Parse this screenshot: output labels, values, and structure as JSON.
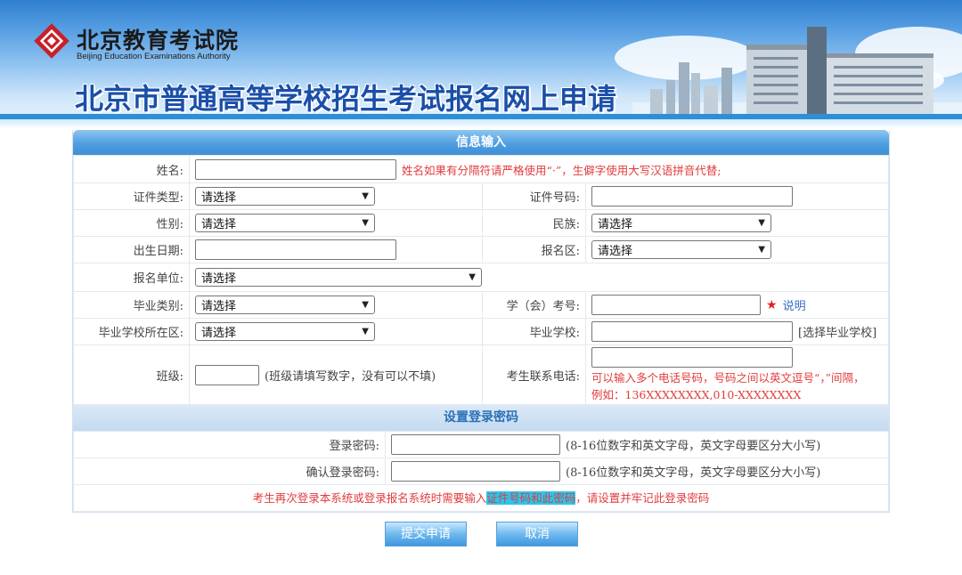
{
  "header": {
    "org_name_cn": "北京教育考试院",
    "org_name_en": "Beijing Education Examinations Authority",
    "site_title": "北京市普通高等学校招生考试报名网上申请"
  },
  "info_section": {
    "title": "信息输入",
    "name_label": "姓名:",
    "name_hint": "姓名如果有分隔符请严格使用“·”，生僻字使用大写汉语拼音代替;",
    "id_type_label": "证件类型:",
    "id_type_value": "请选择",
    "id_number_label": "证件号码:",
    "gender_label": "性别:",
    "gender_value": "请选择",
    "ethnicity_label": "民族:",
    "ethnicity_value": "请选择",
    "birth_label": "出生日期:",
    "district_label": "报名区:",
    "district_value": "请选择",
    "unit_label": "报名单位:",
    "unit_value": "请选择",
    "grad_type_label": "毕业类别:",
    "grad_type_value": "请选择",
    "exam_no_label": "学（会）考号:",
    "exam_no_star": "★",
    "exam_no_link": "说明",
    "school_district_label": "毕业学校所在区:",
    "school_district_value": "请选择",
    "school_label": "毕业学校:",
    "school_select_link": "[选择毕业学校]",
    "class_label": "班级:",
    "class_hint": "(班级请填写数字，没有可以不填)",
    "phone_label": "考生联系电话:",
    "phone_hint_1": "可以输入多个电话号码，号码之间以英文逗号“，”间隔，",
    "phone_hint_2": "例如：136XXXXXXXX,010-XXXXXXXX"
  },
  "password_section": {
    "title": "设置登录密码",
    "password_label": "登录密码:",
    "password_hint": "(8-16位数字和英文字母，英文字母要区分大小写)",
    "confirm_label": "确认登录密码:",
    "confirm_hint": "(8-16位数字和英文字母，英文字母要区分大小写)",
    "note_before": "考生再次登录本系统或登录报名系统时需要输入",
    "note_highlight": "证件号码和此密码",
    "note_after": "，请设置并牢记此登录密码"
  },
  "actions": {
    "submit_label": "提交申请",
    "cancel_label": "取消"
  },
  "colors": {
    "header_blue": "#4f9ee0",
    "title_blue": "#1a4fa8",
    "hint_red": "#e23b3b",
    "highlight_cyan": "#27c7f0"
  }
}
